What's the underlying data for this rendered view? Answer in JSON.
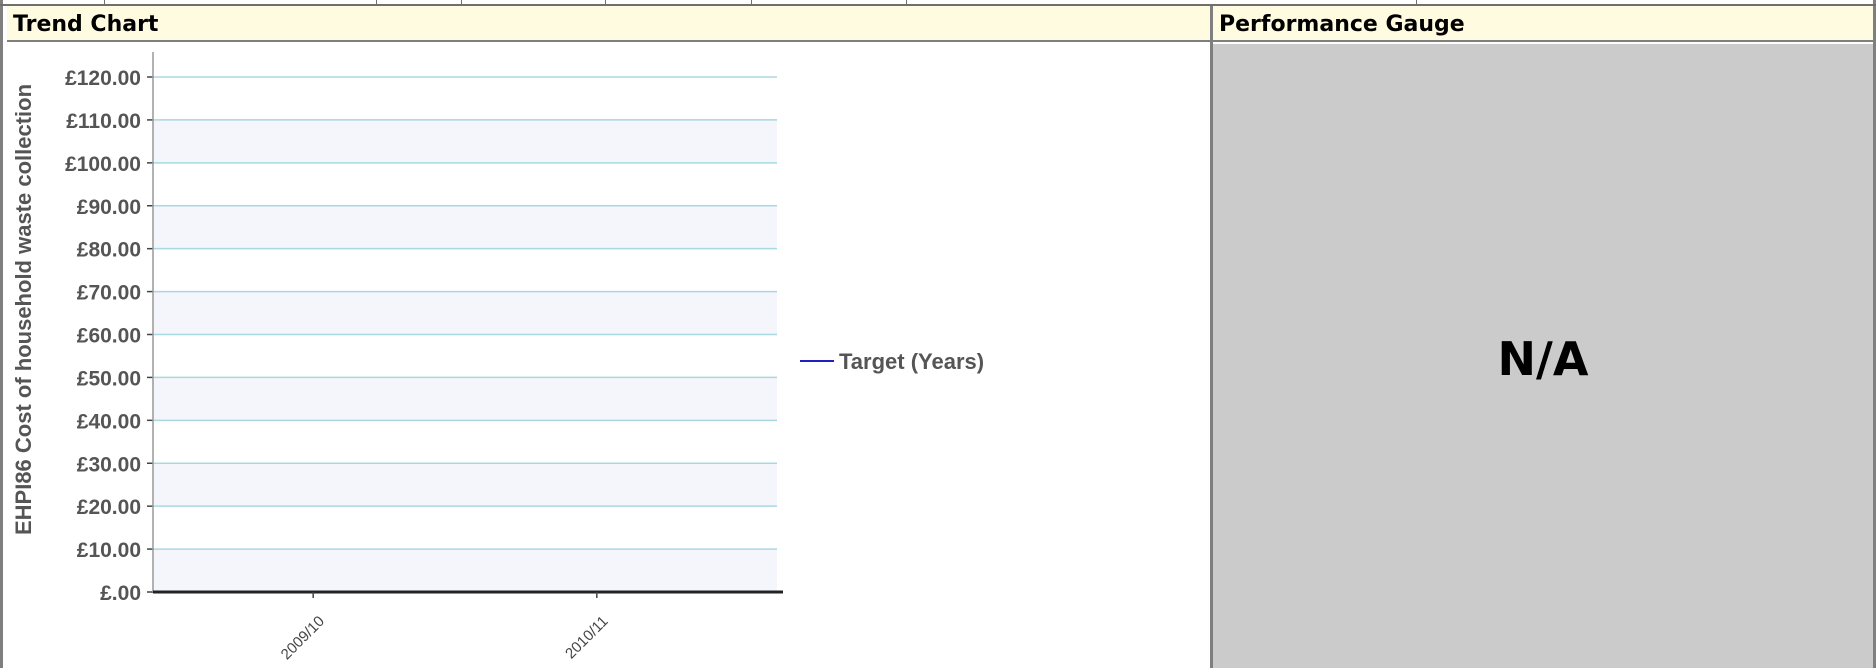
{
  "panels": {
    "trend_title": "Trend Chart",
    "gauge_title": "Performance Gauge",
    "gauge_value": "N/A"
  },
  "colors": {
    "header_bg": "#fffbe0",
    "gauge_bg": "#cbcbcb",
    "grid_line": "#a8d8e0",
    "band_fill": "#f4f6fc",
    "series_target": "#2020c0"
  },
  "chart_data": {
    "type": "line",
    "ylabel": "EHPI86 Cost of household waste collection",
    "xlabel": "",
    "categories": [
      "2009/10",
      "2010/11"
    ],
    "ylim": [
      0,
      120
    ],
    "y_ticks": [
      "£120.00",
      "£110.00",
      "£100.00",
      "£90.00",
      "£80.00",
      "£70.00",
      "£60.00",
      "£50.00",
      "£40.00",
      "£30.00",
      "£20.00",
      "£10.00",
      "£.00"
    ],
    "series": [
      {
        "name": "Target (Years)",
        "values": [
          null,
          null
        ]
      }
    ],
    "legend_position": "right",
    "grid": true
  }
}
